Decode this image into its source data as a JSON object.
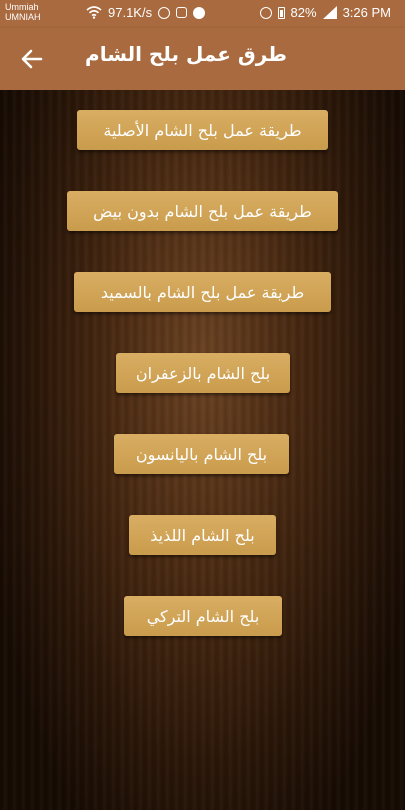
{
  "status_bar": {
    "carrier_line1": "Ummiah",
    "carrier_line2": "UMNIAH",
    "network_speed": "97.1K/s",
    "battery": "82%",
    "time": "3:26 PM"
  },
  "app_bar": {
    "title": "طرق عمل بلح الشام",
    "back_icon": "arrow-left-icon"
  },
  "menu": {
    "items": [
      {
        "label": "طريقة عمل بلح الشام الأصلية"
      },
      {
        "label": "طريقة عمل بلح الشام بدون بيض"
      },
      {
        "label": "طريقة عمل بلح الشام بالسميد"
      },
      {
        "label": "بلح الشام بالزعفران"
      },
      {
        "label": "بلح الشام باليانسون"
      },
      {
        "label": "بلح الشام اللذيذ"
      },
      {
        "label": "بلح الشام التركي"
      }
    ]
  },
  "colors": {
    "app_bar": "#a86a3e",
    "button": "#d4a85a",
    "background": "#2a1608"
  }
}
